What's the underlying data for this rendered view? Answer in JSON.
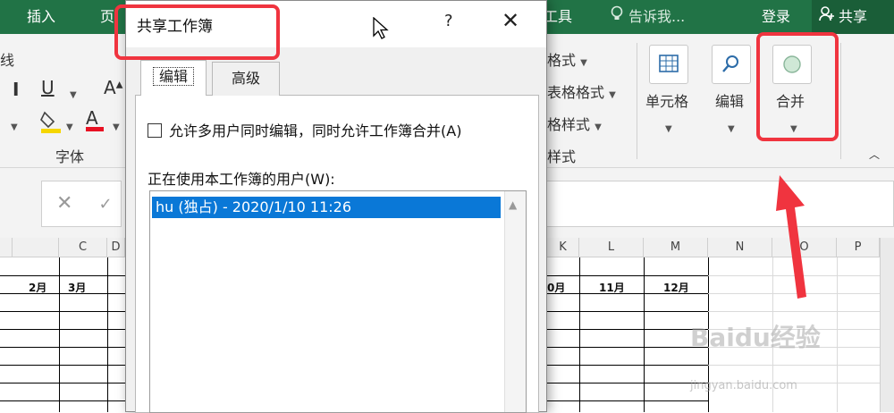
{
  "menubar": {
    "insert": "插入",
    "page_partial": "页",
    "tools_partial": "工具",
    "tell_me": "告诉我...",
    "login": "登录",
    "share": "共享"
  },
  "ribbon": {
    "partial_left": "线",
    "font_group": "字体",
    "cond_format": "格式",
    "table_format": "表格格式",
    "cell_style": "格样式",
    "style_group": "样式",
    "cells": "单元格",
    "edit": "编辑",
    "merge": "合并"
  },
  "sheet": {
    "col_headers": [
      "C",
      "D",
      "K",
      "L",
      "M",
      "N",
      "O",
      "P"
    ],
    "month_headers": [
      "2月",
      "3月",
      "0月",
      "11月",
      "12月"
    ]
  },
  "dialog": {
    "title": "共享工作簿",
    "help": "?",
    "close": "✕",
    "tabs": [
      "编辑",
      "高级"
    ],
    "allow_multiuser": "允许多用户同时编辑，同时允许工作簿合并(A)",
    "allow_checked": false,
    "users_label": "正在使用本工作簿的用户(W):",
    "users": [
      "hu (独占) - 2020/1/10 11:26"
    ]
  },
  "watermark": {
    "main": "Baidu经验",
    "sub": "jingyan.baidu.com"
  },
  "colors": {
    "excel_green": "#217346",
    "selection_blue": "#0a78d7",
    "annotation_red": "#f0343f"
  }
}
